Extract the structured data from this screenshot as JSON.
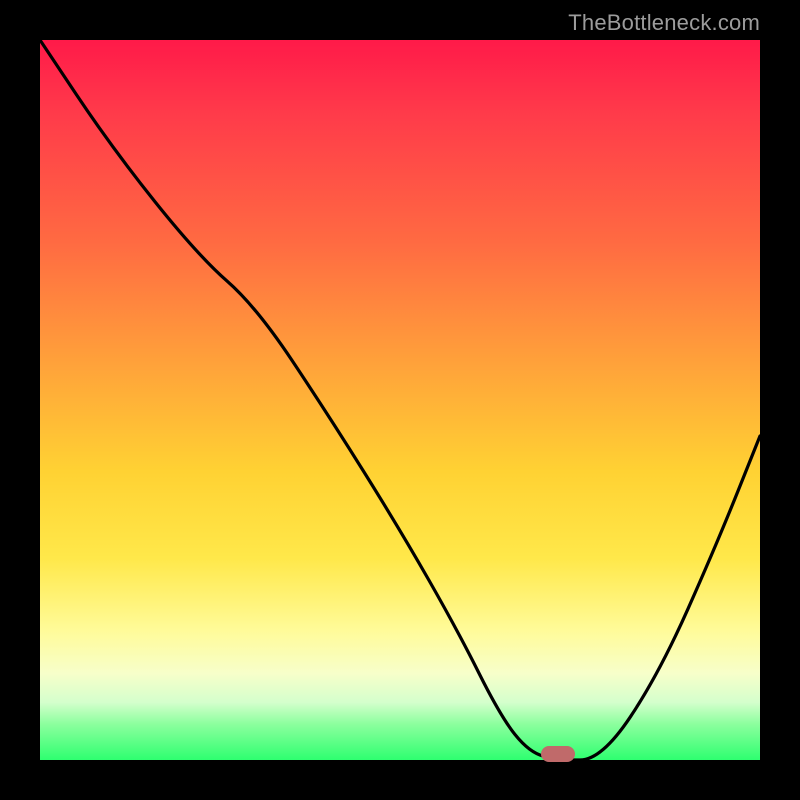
{
  "attribution": "TheBottleneck.com",
  "chart_data": {
    "type": "line",
    "title": "",
    "xlabel": "",
    "ylabel": "",
    "xlim": [
      0,
      100
    ],
    "ylim": [
      0,
      100
    ],
    "background_gradient": {
      "direction": "vertical",
      "stops": [
        {
          "pos": 0,
          "color": "#ff1a49"
        },
        {
          "pos": 10,
          "color": "#ff3a4a"
        },
        {
          "pos": 28,
          "color": "#ff6a42"
        },
        {
          "pos": 45,
          "color": "#ffa23a"
        },
        {
          "pos": 60,
          "color": "#ffd233"
        },
        {
          "pos": 72,
          "color": "#ffe84a"
        },
        {
          "pos": 82,
          "color": "#fffb99"
        },
        {
          "pos": 88,
          "color": "#f7ffca"
        },
        {
          "pos": 92,
          "color": "#d4ffcc"
        },
        {
          "pos": 95,
          "color": "#8cff9e"
        },
        {
          "pos": 100,
          "color": "#2eff70"
        }
      ]
    },
    "series": [
      {
        "name": "curve",
        "x": [
          0,
          10,
          22,
          30,
          40,
          50,
          58,
          64,
          68,
          72,
          78,
          86,
          94,
          100
        ],
        "y": [
          100,
          85,
          70,
          63,
          48,
          32,
          18,
          6,
          1,
          0,
          0,
          12,
          30,
          45
        ]
      }
    ],
    "marker": {
      "x": 72,
      "y": 0,
      "color": "#c06a6a"
    }
  }
}
